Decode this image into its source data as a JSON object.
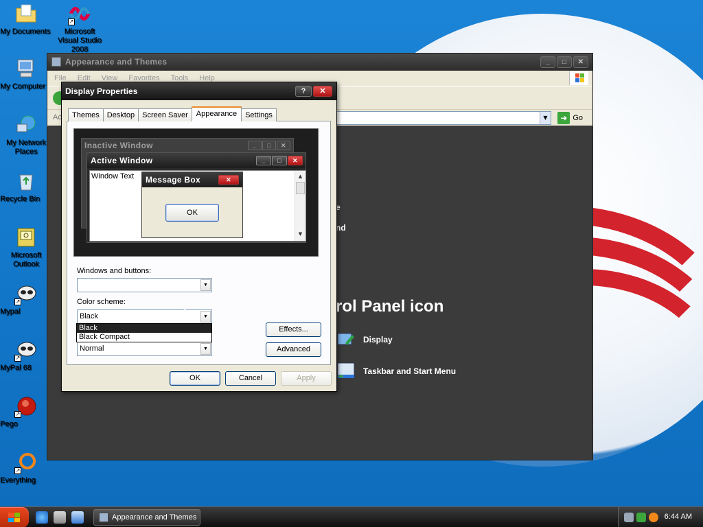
{
  "desktop": {
    "icons": [
      {
        "label": "My Documents",
        "icon": "folder-documents-icon"
      },
      {
        "label": "Microsoft Visual Studio 2008",
        "icon": "visual-studio-icon"
      },
      {
        "label": "My Computer",
        "icon": "computer-icon"
      },
      {
        "label": "My Network Places",
        "icon": "network-places-icon"
      },
      {
        "label": "Recycle Bin",
        "icon": "recycle-bin-icon"
      },
      {
        "label": "Microsoft Outlook",
        "icon": "outlook-icon"
      },
      {
        "label": "Mypal",
        "icon": "mypal-icon"
      },
      {
        "label": "MyPal 68",
        "icon": "mypal68-icon"
      },
      {
        "label": "Pego",
        "icon": "pego-icon"
      },
      {
        "label": "Everything",
        "icon": "everything-icon"
      }
    ]
  },
  "control_panel": {
    "title": "Appearance and Themes",
    "menu": [
      "File",
      "Edit",
      "View",
      "Favorites",
      "Tools",
      "Help"
    ],
    "address_label": "Ac",
    "go_label": "Go",
    "heading": "rol Panel icon",
    "fragment_1": "e",
    "fragment_2": "nd",
    "links": [
      {
        "label": "Display",
        "icon": "display-icon"
      },
      {
        "label": "Taskbar and Start Menu",
        "icon": "taskbar-start-menu-icon"
      }
    ]
  },
  "dialog": {
    "title": "Display Properties",
    "help_label": "?",
    "close_label": "✕",
    "tabs": [
      "Themes",
      "Desktop",
      "Screen Saver",
      "Appearance",
      "Settings"
    ],
    "active_tab": "Appearance",
    "preview": {
      "inactive_title": "Inactive Window",
      "active_title": "Active Window",
      "window_text": "Window Text",
      "message_title": "Message Box",
      "ok_label": "OK"
    },
    "windows_buttons_label": "Windows and buttons:",
    "windows_buttons_value": "",
    "color_scheme_label": "Color scheme:",
    "color_scheme_value": "Black",
    "color_scheme_options": [
      "Black",
      "Black Compact"
    ],
    "font_size_value": "Normal",
    "effects_label": "Effects...",
    "advanced_label": "Advanced",
    "ok_label": "OK",
    "cancel_label": "Cancel",
    "apply_label": "Apply"
  },
  "taskbar": {
    "task_label": "Appearance and Themes",
    "clock": "6:44 AM"
  },
  "colors": {
    "desktop_blue": "#1276c8",
    "window_dark": "#3b3b3b",
    "dialog_face": "#ece9d8",
    "close_red": "#c82020",
    "tab_accent": "#e68b2c"
  }
}
